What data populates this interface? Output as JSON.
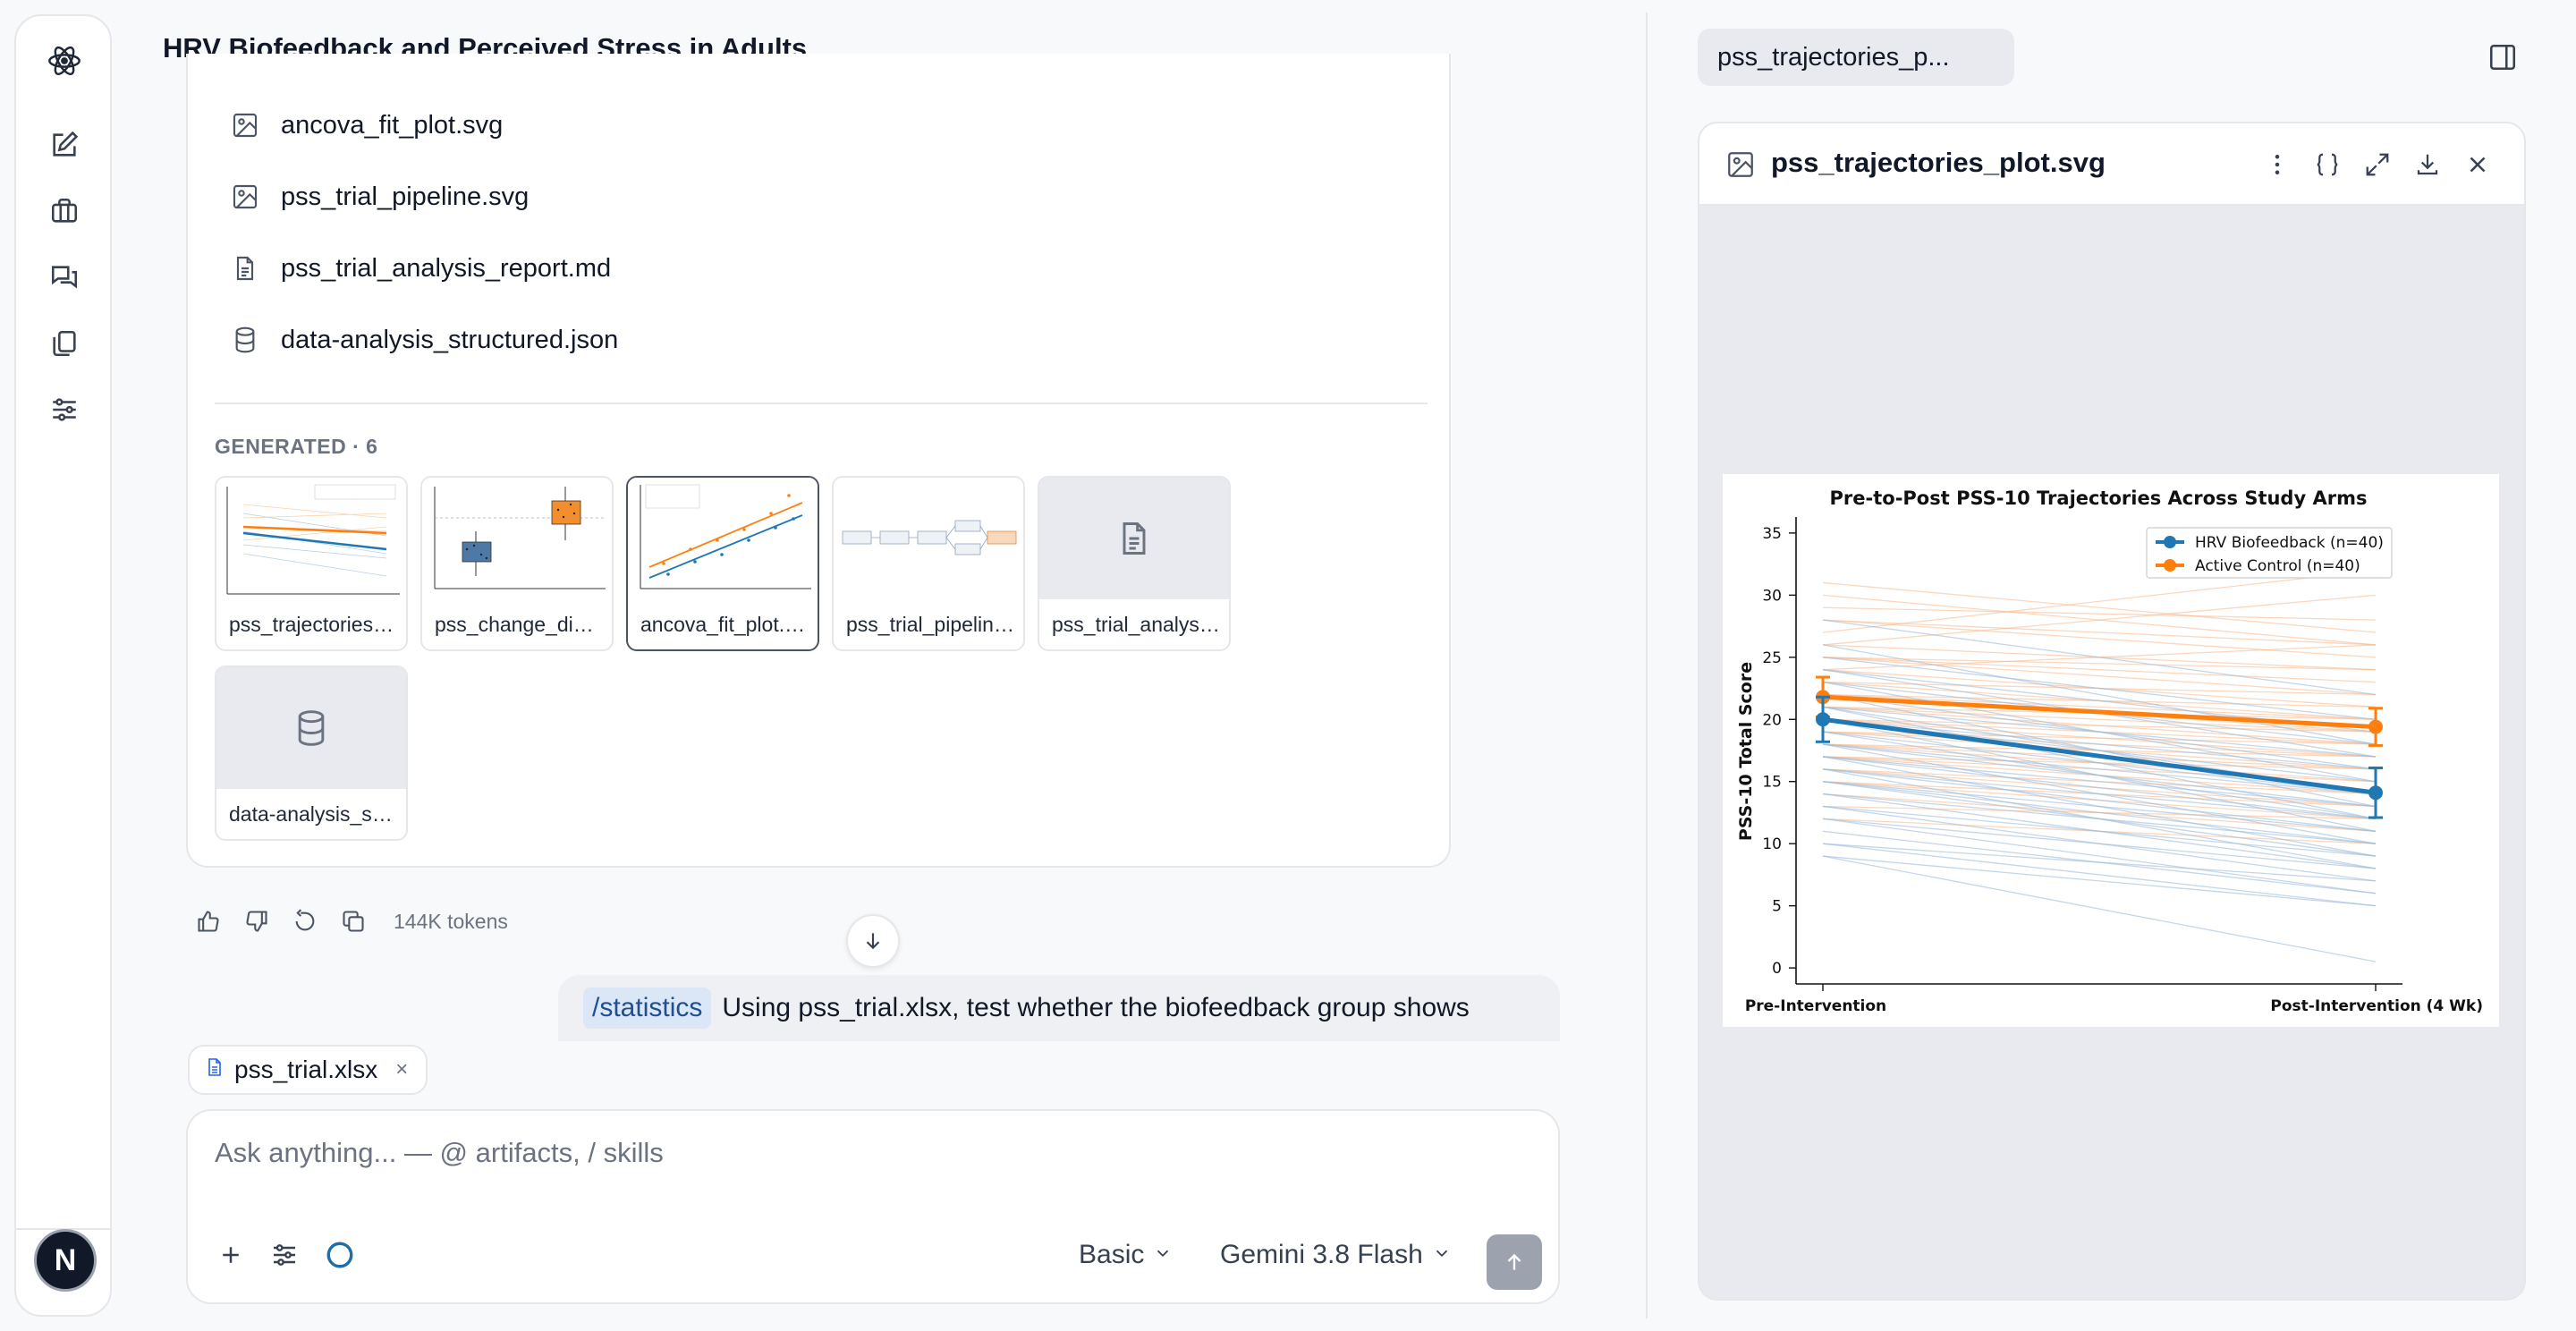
{
  "app": {
    "conversation_title": "HRV Biofeedback and Perceived Stress in Adults"
  },
  "rail": {
    "logo_icon": "atom-icon",
    "items": [
      "new-chat-icon",
      "briefcase-icon",
      "chats-icon",
      "copy-icon",
      "sliders-icon"
    ],
    "avatar_letter": "N"
  },
  "files": [
    {
      "name": "ancova_fit_plot.svg",
      "icon": "image-icon"
    },
    {
      "name": "pss_trial_pipeline.svg",
      "icon": "image-icon"
    },
    {
      "name": "pss_trial_analysis_report.md",
      "icon": "document-icon"
    },
    {
      "name": "data-analysis_structured.json",
      "icon": "database-icon"
    }
  ],
  "generated": {
    "label": "GENERATED · 6",
    "items": [
      {
        "caption": "pss_trajectories_plot.svg",
        "kind": "trajectory"
      },
      {
        "caption": "pss_change_distribution.svg",
        "kind": "boxplot"
      },
      {
        "caption": "ancova_fit_plot.svg",
        "kind": "scatter",
        "selected": true
      },
      {
        "caption": "pss_trial_pipeline.svg",
        "kind": "pipeline"
      },
      {
        "caption": "pss_trial_analysis_report.md",
        "kind": "document-icon"
      },
      {
        "caption": "data-analysis_structured.json",
        "kind": "database-icon"
      }
    ]
  },
  "message_actions": {
    "tokens": "144K tokens"
  },
  "user_message": {
    "skill": "/statistics",
    "text": "Using pss_trial.xlsx, test whether the biofeedback group shows"
  },
  "attachment": {
    "name": "pss_trial.xlsx",
    "remove": "×"
  },
  "composer": {
    "placeholder": "Ask anything... — @ artifacts, / skills",
    "mode": "Basic",
    "model": "Gemini 3.8 Flash"
  },
  "right_panel": {
    "tab_label": "pss_trajectories_p...",
    "viewer_title": "pss_trajectories_plot.svg",
    "toolbar_icons": [
      "more-vertical-icon",
      "braces-icon",
      "expand-icon",
      "download-icon",
      "close-icon"
    ]
  },
  "chart_data": {
    "type": "line",
    "title": "Pre-to-Post PSS-10 Trajectories Across Study Arms",
    "xlabel": "",
    "ylabel": "PSS-10 Total Score",
    "categories": [
      "Pre-Intervention",
      "Post-Intervention (4 Wk)"
    ],
    "ylim": [
      -1,
      36
    ],
    "yticks": [
      0,
      5,
      10,
      15,
      20,
      25,
      30,
      35
    ],
    "grid": false,
    "legend_position": "top-right",
    "series": [
      {
        "name": "HRV Biofeedback (n=40)",
        "color": "#1f77b4",
        "values": [
          20.0,
          14.1
        ],
        "error": [
          1.8,
          2.0
        ]
      },
      {
        "name": "Active Control (n=40)",
        "color": "#ff7f0e",
        "values": [
          21.8,
          19.4
        ],
        "error": [
          1.6,
          1.5
        ]
      }
    ],
    "individual_trajectories": {
      "hrv": [
        [
          28,
          22
        ],
        [
          26,
          18
        ],
        [
          25,
          20
        ],
        [
          24,
          17
        ],
        [
          23,
          15
        ],
        [
          22,
          16
        ],
        [
          22,
          13
        ],
        [
          21,
          14
        ],
        [
          21,
          12
        ],
        [
          20,
          15
        ],
        [
          20,
          11
        ],
        [
          19,
          14
        ],
        [
          19,
          12
        ],
        [
          18,
          13
        ],
        [
          18,
          10
        ],
        [
          17,
          12
        ],
        [
          17,
          9
        ],
        [
          16,
          11
        ],
        [
          16,
          8
        ],
        [
          15,
          10
        ],
        [
          15,
          9
        ],
        [
          14,
          8
        ],
        [
          14,
          10
        ],
        [
          13,
          7
        ],
        [
          13,
          9
        ],
        [
          12,
          8
        ],
        [
          11,
          6
        ],
        [
          10,
          7
        ],
        [
          9,
          5
        ],
        [
          9,
          0.5
        ],
        [
          24,
          19
        ],
        [
          23,
          18
        ],
        [
          21,
          17
        ],
        [
          20,
          16
        ],
        [
          18,
          14
        ],
        [
          17,
          13
        ],
        [
          16,
          12
        ],
        [
          15,
          11
        ],
        [
          12,
          6
        ],
        [
          10,
          5
        ]
      ],
      "control": [
        [
          31,
          27
        ],
        [
          30,
          26
        ],
        [
          29,
          28
        ],
        [
          28,
          25
        ],
        [
          27,
          32
        ],
        [
          26,
          24
        ],
        [
          25,
          22
        ],
        [
          25,
          23
        ],
        [
          24,
          21
        ],
        [
          23,
          20
        ],
        [
          23,
          22
        ],
        [
          22,
          19
        ],
        [
          22,
          20
        ],
        [
          21,
          18
        ],
        [
          21,
          19
        ],
        [
          20,
          17
        ],
        [
          20,
          18
        ],
        [
          19,
          16
        ],
        [
          19,
          17
        ],
        [
          18,
          15
        ],
        [
          18,
          16
        ],
        [
          17,
          14
        ],
        [
          17,
          15
        ],
        [
          16,
          13
        ],
        [
          15,
          12
        ],
        [
          14,
          11
        ],
        [
          13,
          12
        ],
        [
          12,
          10
        ],
        [
          24,
          26
        ],
        [
          26,
          30
        ],
        [
          22,
          21
        ],
        [
          21,
          20
        ],
        [
          20,
          19
        ],
        [
          19,
          18
        ],
        [
          18,
          17
        ],
        [
          17,
          16
        ],
        [
          16,
          14
        ],
        [
          15,
          13
        ],
        [
          28,
          26
        ],
        [
          25,
          24
        ]
      ]
    }
  }
}
